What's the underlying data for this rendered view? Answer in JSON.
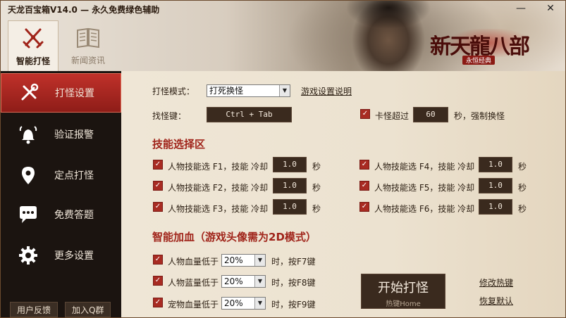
{
  "title": "天龙百宝箱V14.0 — 永久免费绿色辅助",
  "window": {
    "minimize": "—",
    "close": "✕"
  },
  "logo": {
    "text": "新天龍八部",
    "subtitle": "永恒经典"
  },
  "top_tabs": [
    {
      "label": "智能打怪",
      "icon": "crossed-swords-icon",
      "active": true
    },
    {
      "label": "新闻资讯",
      "icon": "book-icon",
      "active": false
    }
  ],
  "sidebar": {
    "items": [
      {
        "label": "打怪设置",
        "icon": "tools-icon",
        "active": true
      },
      {
        "label": "验证报警",
        "icon": "bell-icon",
        "active": false
      },
      {
        "label": "定点打怪",
        "icon": "location-pin-icon",
        "active": false
      },
      {
        "label": "免费答题",
        "icon": "chat-bubble-icon",
        "active": false
      },
      {
        "label": "更多设置",
        "icon": "gear-icon",
        "active": false
      }
    ],
    "feedback": "用户反馈",
    "join_group": "加入Q群"
  },
  "main": {
    "mode_label": "打怪模式：",
    "mode_value": "打死换怪",
    "game_help_link": "游戏设置说明",
    "find_key_label": "找怪键：",
    "find_key_value": "Ctrl + Tab",
    "stuck_label": "卡怪超过",
    "stuck_value": "60",
    "stuck_suffix": "秒，强制换怪",
    "skills_title": "技能选择区",
    "skills": [
      {
        "label": "人物技能选 F1，技能 冷却",
        "value": "1.0",
        "unit": "秒",
        "checked": true
      },
      {
        "label": "人物技能选 F2，技能 冷却",
        "value": "1.0",
        "unit": "秒",
        "checked": true
      },
      {
        "label": "人物技能选 F3，技能 冷却",
        "value": "1.0",
        "unit": "秒",
        "checked": true
      },
      {
        "label": "人物技能选 F4，技能 冷却",
        "value": "1.0",
        "unit": "秒",
        "checked": true
      },
      {
        "label": "人物技能选 F5，技能 冷却",
        "value": "1.0",
        "unit": "秒",
        "checked": true
      },
      {
        "label": "人物技能选 F6，技能 冷却",
        "value": "1.0",
        "unit": "秒",
        "checked": true
      }
    ],
    "heal_title": "智能加血（游戏头像需为2D模式）",
    "heal": [
      {
        "label": "人物血量低于",
        "value": "20%",
        "suffix": "时，按F7键",
        "checked": true
      },
      {
        "label": "人物蓝量低于",
        "value": "20%",
        "suffix": "时，按F8键",
        "checked": true
      },
      {
        "label": "宠物血量低于",
        "value": "20%",
        "suffix": "时，按F9键",
        "checked": true
      }
    ],
    "start_button": "开始打怪",
    "start_hotkey": "热键Home",
    "modify_hotkey": "修改热键",
    "restore_default": "恢复默认"
  },
  "colors": {
    "accent": "#a82b22",
    "sidebar_bg": "#1b1410",
    "dark_box": "#3a2a1e"
  }
}
